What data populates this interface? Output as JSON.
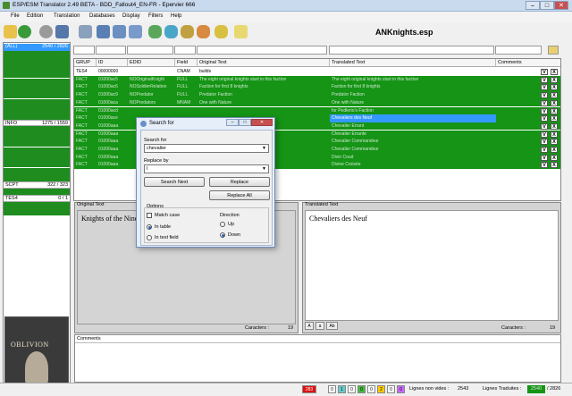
{
  "window": {
    "title": "ESP/ESM Translator 2.49 BETA - BDD_Fallout4_EN-FR - Epervier 666",
    "min": "–",
    "max": "□",
    "close": "✕"
  },
  "menu": [
    "File",
    "Edition",
    "Translation",
    "Databases",
    "Display",
    "Filters",
    "Help"
  ],
  "file_name": "ANKnights.esp",
  "left_list": [
    {
      "label": "(ALL)",
      "count": "2540 / 2826",
      "style": "sel"
    },
    {
      "label": "ACTI",
      "count": "55 / 55",
      "style": "g"
    },
    {
      "label": "AMMO",
      "count": "43 / 43",
      "style": "g"
    },
    {
      "label": "BOOK",
      "count": "30 / 30",
      "style": "g"
    },
    {
      "label": "CELL",
      "count": "93 / 93",
      "style": "g"
    },
    {
      "label": "CLOT",
      "count": "1 / 1",
      "style": "g"
    },
    {
      "label": "CONT",
      "count": "17 / 17",
      "style": "g"
    },
    {
      "label": "CREA",
      "count": "51 / 51",
      "style": "g"
    },
    {
      "label": "DIAL",
      "count": "288 / 288",
      "style": "g"
    },
    {
      "label": "DOOR",
      "count": "9 / 9",
      "style": "g"
    },
    {
      "label": "FACT",
      "count": "13 / 13",
      "style": "g"
    },
    {
      "label": "INFO",
      "count": "1275 / 1559",
      "style": "w"
    },
    {
      "label": "INGR",
      "count": "5 / 5",
      "style": "g"
    },
    {
      "label": "LIGH",
      "count": "2 / 2",
      "style": "g"
    },
    {
      "label": "MGEF",
      "count": "4 / 4",
      "style": "g"
    },
    {
      "label": "MISC",
      "count": "5 / 5",
      "style": "g"
    },
    {
      "label": "NPC_",
      "count": "70 / 70",
      "style": "g"
    },
    {
      "label": "QUST",
      "count": "245 / 245",
      "style": "g"
    },
    {
      "label": "REFR",
      "count": "1 / 1",
      "style": "g"
    },
    {
      "label": "REGN",
      "count": "2 / 2",
      "style": "g"
    },
    {
      "label": "SCPT",
      "count": "322 / 323",
      "style": "w"
    },
    {
      "label": "SPEL",
      "count": "37 / 37",
      "style": "g"
    },
    {
      "label": "TES4",
      "count": "0 / 1",
      "style": "w"
    },
    {
      "label": "WEAP",
      "count": "44 / 44",
      "style": "g"
    },
    {
      "label": "WRLD",
      "count": "2 / 2",
      "style": "g"
    }
  ],
  "cover_logo": "OBLIVION",
  "grid": {
    "headers": [
      "GRUP",
      "ID",
      "EDID",
      "Field",
      "Original Text",
      "Translated Text",
      "Comments"
    ],
    "rows": [
      {
        "grup": "TES4",
        "id": "00000000",
        "edid": "",
        "field": "CNAM",
        "orig": "builds",
        "trans": "",
        "style": "white"
      },
      {
        "grup": "FACT",
        "id": "01000ac5",
        "edid": "NOOriginalKnight",
        "field": "FULL",
        "orig": "The eight original knights start in this faction",
        "trans": "The eight original knights start in this faction",
        "style": "green"
      },
      {
        "grup": "FACT",
        "id": "01000ac6",
        "edid": "NOSoldierRelation",
        "field": "FULL",
        "orig": "Faction for first 8 knights",
        "trans": "Faction for first 8 knights",
        "style": "green"
      },
      {
        "grup": "FACT",
        "id": "01000ac9",
        "edid": "NOPredator",
        "field": "FULL",
        "orig": "Predator Faction",
        "trans": "Predator Faction",
        "style": "green"
      },
      {
        "grup": "FACT",
        "id": "01000aca",
        "edid": "NOPredators",
        "field": "MNAM",
        "orig": "One with Nature",
        "trans": "One with Nature",
        "style": "green"
      },
      {
        "grup": "FACT",
        "id": "01000acd",
        "edid": "",
        "field": "",
        "orig": "",
        "trans": "for Pedlerio's Faction",
        "style": "green"
      },
      {
        "grup": "FACT",
        "id": "01000ace",
        "edid": "",
        "field": "",
        "orig": "",
        "trans": "Chevaliers des Neuf",
        "style": "hl"
      },
      {
        "grup": "FACT",
        "id": "01000aaa",
        "edid": "",
        "field": "",
        "orig": "",
        "trans": "Chevalier Errant",
        "style": "green"
      },
      {
        "grup": "FACT",
        "id": "01000aaa",
        "edid": "",
        "field": "",
        "orig": "",
        "trans": "Chevalier Errante",
        "style": "green"
      },
      {
        "grup": "FACT",
        "id": "01000aaa",
        "edid": "",
        "field": "",
        "orig": "",
        "trans": "Chevalier Commandeur",
        "style": "green"
      },
      {
        "grup": "FACT",
        "id": "01000aaa",
        "edid": "",
        "field": "",
        "orig": "",
        "trans": "Chevalier Commandeur",
        "style": "green"
      },
      {
        "grup": "FACT",
        "id": "01000aaa",
        "edid": "",
        "field": "",
        "orig": "",
        "trans": "Divin Coud",
        "style": "green"
      },
      {
        "grup": "FACT",
        "id": "01000aaa",
        "edid": "",
        "field": "",
        "orig": "",
        "trans": "Divine Croisée",
        "style": "green"
      }
    ],
    "v": "V",
    "x": "X"
  },
  "original_pane": {
    "caption": "Original Text",
    "text": "Knights of the Nine",
    "chars_label": "Caracters :",
    "chars": "19"
  },
  "translated_pane": {
    "caption": "Translated Text",
    "text": "Chevaliers des Neuf",
    "chars_label": "Caracters :",
    "chars": "19",
    "btn_a_small": "A",
    "btn_a": "a",
    "btn_ab": "Ab"
  },
  "comments": {
    "caption": "Comments"
  },
  "dialog": {
    "title": "Search for",
    "search_label": "Search for",
    "search_value": "chevalier",
    "replace_label": "Replace by",
    "replace_value": "l",
    "btn_search_next": "Search Next",
    "btn_replace": "Replace",
    "btn_replace_all": "Replace All",
    "options_label": "Options",
    "match_case": "Match case",
    "in_table": "In table",
    "in_text_field": "In text field",
    "direction_label": "Direction",
    "up": "Up",
    "down": "Down"
  },
  "status": {
    "counts": [
      "283",
      "0",
      "1",
      "0",
      "0",
      "0",
      "2",
      "0",
      "0"
    ],
    "colors": [
      "#d11",
      "#fff",
      "#6cc",
      "#fff",
      "#4b4",
      "#fff",
      "#fc0",
      "#fff",
      "#c6f"
    ],
    "non_empty_label": "Lignes non vides :",
    "non_empty": "2543",
    "translated_label": "Lignes Traduites :",
    "translated": "2540",
    "total": "/ 2826"
  },
  "colors": {
    "green": "#159415",
    "highlight": "#3399ff"
  }
}
